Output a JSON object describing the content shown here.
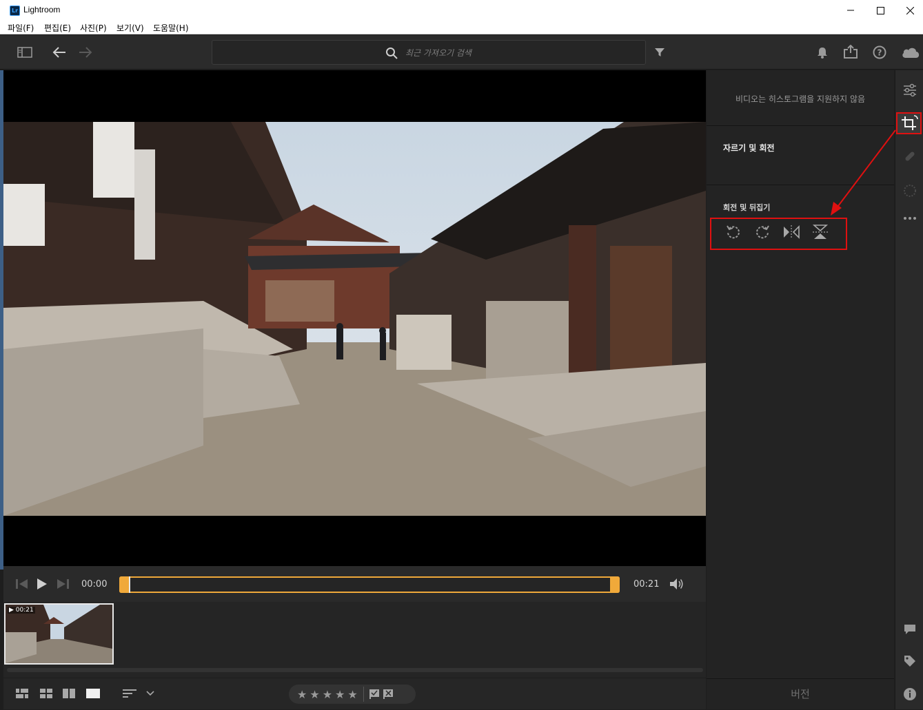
{
  "window": {
    "title": "Lightroom",
    "logo": "Lr"
  },
  "menubar": [
    {
      "label": "파일(F)"
    },
    {
      "label": "편집(E)"
    },
    {
      "label": "사진(P)"
    },
    {
      "label": "보기(V)"
    },
    {
      "label": "도움말(H)"
    }
  ],
  "toolbar": {
    "search_placeholder": "최근 가져오기 검색"
  },
  "player": {
    "current_time": "00:00",
    "duration": "00:21",
    "thumb_duration": "00:21"
  },
  "panel": {
    "histogram_note": "비디오는 히스토그램을 지원하지 않음",
    "crop_section_title": "자르기 및 회전",
    "rotate_flip_title": "회전 및 뒤집기",
    "version_label": "버전"
  },
  "icons": {
    "rotate_left": "rotate-left-icon",
    "rotate_right": "rotate-right-icon",
    "flip_horizontal": "flip-horizontal-icon",
    "flip_vertical": "flip-vertical-icon"
  },
  "colors": {
    "accent": "#f0a93a",
    "highlight": "#e01010",
    "panel_bg": "#232323"
  }
}
